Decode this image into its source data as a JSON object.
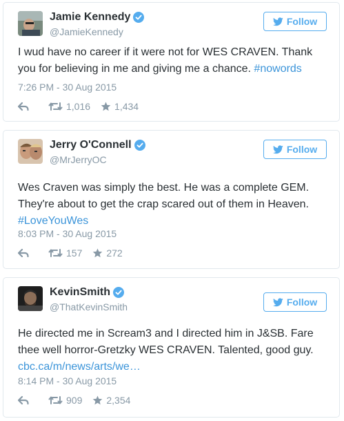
{
  "tweets": [
    {
      "name": "Jamie Kennedy",
      "handle": "@JamieKennedy",
      "follow_label": "Follow",
      "text": "I wud have no career if it were not for WES CRAVEN. Thank you for believing in me and giving me a chance. ",
      "hashtag": "#nowords",
      "timestamp": "7:26 PM - 30 Aug 2015",
      "retweets": "1,016",
      "likes": "1,434"
    },
    {
      "name": "Jerry O'Connell",
      "handle": "@MrJerryOC",
      "follow_label": "Follow",
      "text": "Wes Craven was simply the best. He was a complete GEM. They're about to get the crap scared out of them in Heaven. ",
      "hashtag": "#LoveYouWes",
      "timestamp": "8:03 PM - 30 Aug 2015",
      "retweets": "157",
      "likes": "272"
    },
    {
      "name": "KevinSmith",
      "handle": "@ThatKevinSmith",
      "follow_label": "Follow",
      "text": "He directed me in Scream3 and I directed him in J&SB. Fare thee well horror-Gretzky WES CRAVEN. Talented, good guy. ",
      "link": "cbc.ca/m/news/arts/we…",
      "timestamp": "8:14 PM - 30 Aug 2015",
      "retweets": "909",
      "likes": "2,354"
    }
  ],
  "colors": {
    "accent": "#55acee",
    "link": "#3b94d9",
    "text": "#292f33",
    "muted": "#8899a6",
    "border": "#e1e8ed"
  },
  "icons": {
    "verified": "verified-badge-icon",
    "bird": "twitter-bird-icon",
    "reply": "reply-icon",
    "retweet": "retweet-icon",
    "like": "star-icon"
  }
}
